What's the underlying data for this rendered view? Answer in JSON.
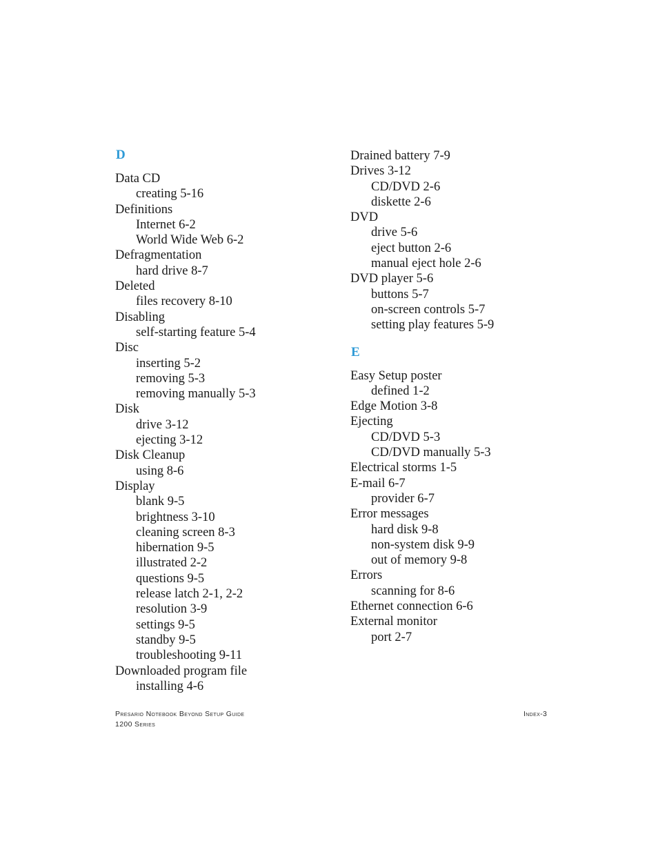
{
  "page": {
    "heading_color": "#2e9ad6",
    "text_color": "#1a1a1a"
  },
  "columns": {
    "left": {
      "sections": [
        {
          "letter": "D",
          "entries": [
            {
              "text": "Data CD",
              "level": 1
            },
            {
              "text": "creating 5-16",
              "level": 2
            },
            {
              "text": "Definitions",
              "level": 1
            },
            {
              "text": "Internet 6-2",
              "level": 2
            },
            {
              "text": "World Wide Web 6-2",
              "level": 2
            },
            {
              "text": "Defragmentation",
              "level": 1
            },
            {
              "text": "hard drive 8-7",
              "level": 2
            },
            {
              "text": "Deleted",
              "level": 1
            },
            {
              "text": "files recovery 8-10",
              "level": 2
            },
            {
              "text": "Disabling",
              "level": 1
            },
            {
              "text": "self-starting feature 5-4",
              "level": 2
            },
            {
              "text": "Disc",
              "level": 1
            },
            {
              "text": "inserting 5-2",
              "level": 2
            },
            {
              "text": "removing 5-3",
              "level": 2
            },
            {
              "text": "removing manually 5-3",
              "level": 2
            },
            {
              "text": "Disk",
              "level": 1
            },
            {
              "text": "drive 3-12",
              "level": 2
            },
            {
              "text": "ejecting 3-12",
              "level": 2
            },
            {
              "text": "Disk Cleanup",
              "level": 1
            },
            {
              "text": "using 8-6",
              "level": 2
            },
            {
              "text": "Display",
              "level": 1
            },
            {
              "text": "blank 9-5",
              "level": 2
            },
            {
              "text": "brightness 3-10",
              "level": 2
            },
            {
              "text": "cleaning screen 8-3",
              "level": 2
            },
            {
              "text": "hibernation 9-5",
              "level": 2
            },
            {
              "text": "illustrated 2-2",
              "level": 2
            },
            {
              "text": "questions 9-5",
              "level": 2
            },
            {
              "text": "release latch 2-1, 2-2",
              "level": 2
            },
            {
              "text": "resolution 3-9",
              "level": 2
            },
            {
              "text": "settings 9-5",
              "level": 2
            },
            {
              "text": "standby 9-5",
              "level": 2
            },
            {
              "text": "troubleshooting 9-11",
              "level": 2
            },
            {
              "text": "Downloaded program file",
              "level": 1
            },
            {
              "text": "installing 4-6",
              "level": 2
            }
          ]
        }
      ]
    },
    "right": {
      "sections": [
        {
          "letter": "",
          "entries": [
            {
              "text": "Drained battery 7-9",
              "level": 1
            },
            {
              "text": "Drives 3-12",
              "level": 1
            },
            {
              "text": "CD/DVD 2-6",
              "level": 2
            },
            {
              "text": "diskette 2-6",
              "level": 2
            },
            {
              "text": "DVD",
              "level": 1
            },
            {
              "text": "drive 5-6",
              "level": 2
            },
            {
              "text": "eject button 2-6",
              "level": 2
            },
            {
              "text": "manual eject hole 2-6",
              "level": 2
            },
            {
              "text": "DVD player 5-6",
              "level": 1
            },
            {
              "text": "buttons 5-7",
              "level": 2
            },
            {
              "text": "on-screen controls 5-7",
              "level": 2
            },
            {
              "text": "setting play features 5-9",
              "level": 2
            }
          ]
        },
        {
          "letter": "E",
          "entries": [
            {
              "text": "Easy Setup poster",
              "level": 1
            },
            {
              "text": "defined 1-2",
              "level": 2
            },
            {
              "text": "Edge Motion 3-8",
              "level": 1
            },
            {
              "text": "Ejecting",
              "level": 1
            },
            {
              "text": "CD/DVD 5-3",
              "level": 2
            },
            {
              "text": "CD/DVD manually 5-3",
              "level": 2
            },
            {
              "text": "Electrical storms 1-5",
              "level": 1
            },
            {
              "text": "E-mail 6-7",
              "level": 1
            },
            {
              "text": "provider 6-7",
              "level": 2
            },
            {
              "text": "Error messages",
              "level": 1
            },
            {
              "text": "hard disk 9-8",
              "level": 2
            },
            {
              "text": "non-system disk 9-9",
              "level": 2
            },
            {
              "text": "out of memory 9-8",
              "level": 2
            },
            {
              "text": "Errors",
              "level": 1
            },
            {
              "text": "scanning for 8-6",
              "level": 2
            },
            {
              "text": "Ethernet connection 6-6",
              "level": 1
            },
            {
              "text": "External monitor",
              "level": 1
            },
            {
              "text": "port 2-7",
              "level": 2
            }
          ]
        }
      ]
    }
  },
  "footer": {
    "left_line1": "Presario Notebook Beyond Setup Guide",
    "left_line2": "1200 Series",
    "right": "Index-3"
  }
}
